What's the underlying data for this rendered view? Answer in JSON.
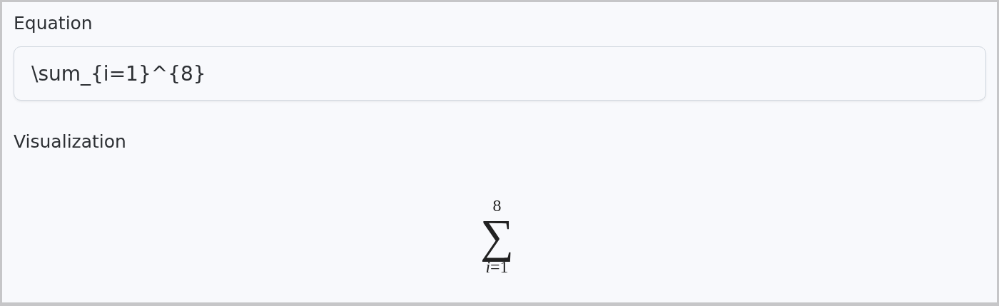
{
  "equation": {
    "label": "Equation",
    "value": "\\sum_{i=1}^{8}"
  },
  "visualization": {
    "label": "Visualization",
    "upper": "8",
    "operator": "∑",
    "lower": "*i*=1"
  }
}
